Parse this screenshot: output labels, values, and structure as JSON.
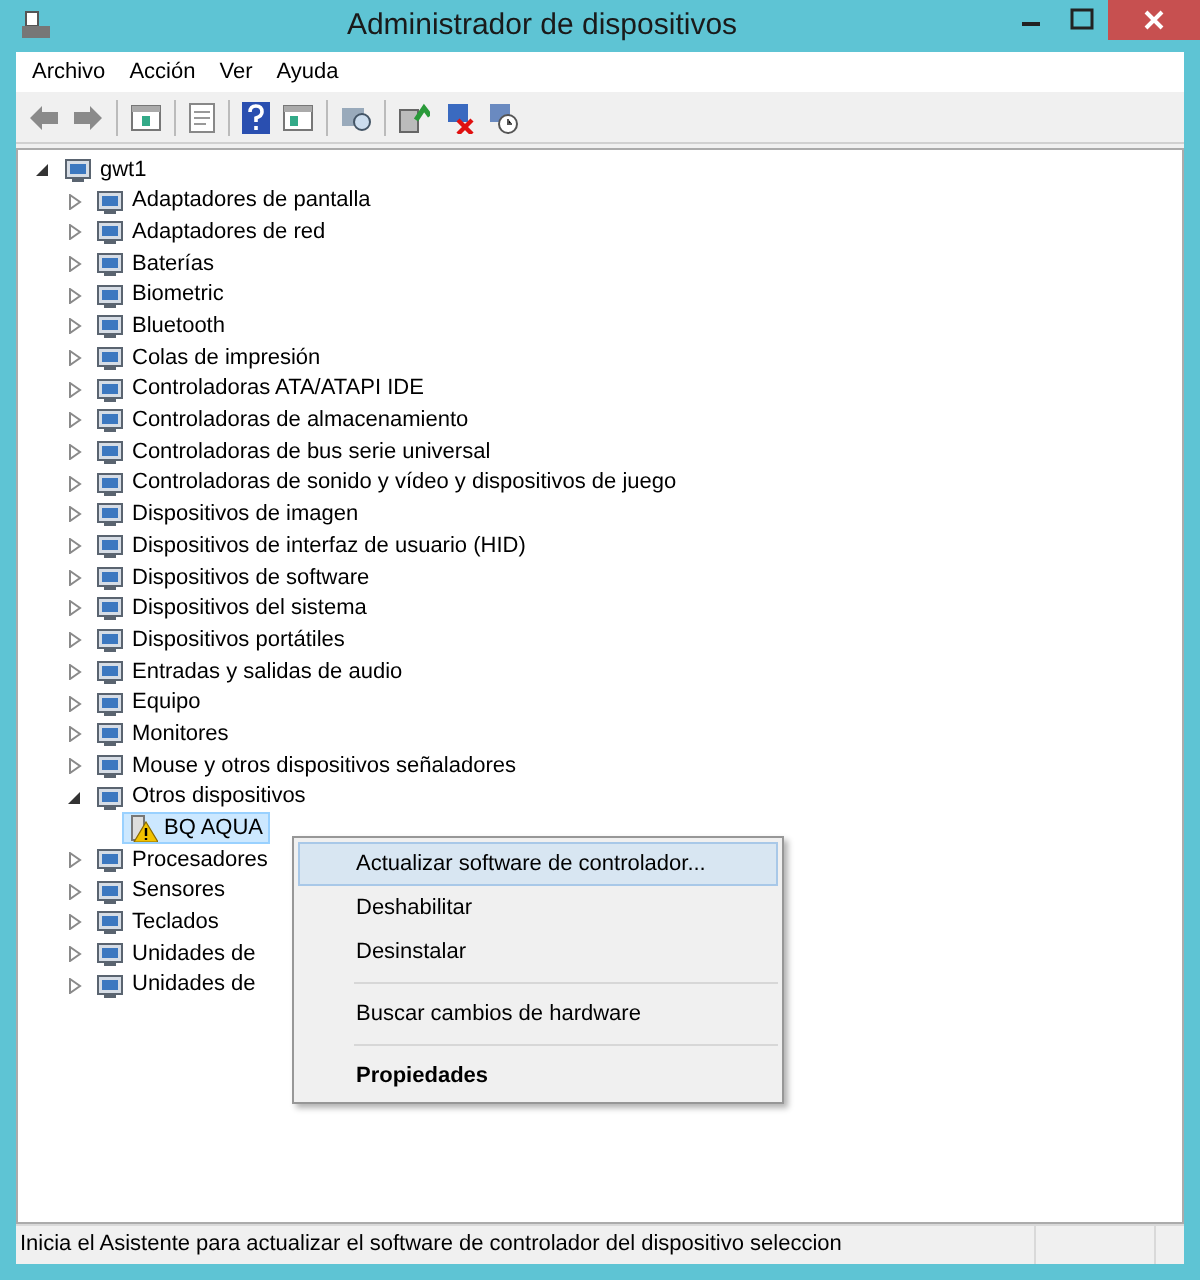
{
  "window": {
    "title": "Administrador de dispositivos"
  },
  "menu_bar": [
    "Archivo",
    "Acción",
    "Ver",
    "Ayuda"
  ],
  "tree": [
    {
      "label": "gwt1",
      "expanded": true,
      "selected": false,
      "children": [
        {
          "label": "Adaptadores de pantalla",
          "expanded": false,
          "selected": false
        },
        {
          "label": "Adaptadores de red",
          "expanded": false,
          "selected": false
        },
        {
          "label": "Baterías",
          "expanded": false,
          "selected": false
        },
        {
          "label": "Biometric",
          "expanded": false,
          "selected": false
        },
        {
          "label": "Bluetooth",
          "expanded": false,
          "selected": false
        },
        {
          "label": "Colas de impresión",
          "expanded": false,
          "selected": false
        },
        {
          "label": "Controladoras ATA/ATAPI IDE",
          "expanded": false,
          "selected": false
        },
        {
          "label": "Controladoras de almacenamiento",
          "expanded": false,
          "selected": false
        },
        {
          "label": "Controladoras de bus serie universal",
          "expanded": false,
          "selected": false
        },
        {
          "label": "Controladoras de sonido y vídeo y dispositivos de juego",
          "expanded": false,
          "selected": false
        },
        {
          "label": "Dispositivos de imagen",
          "expanded": false,
          "selected": false
        },
        {
          "label": "Dispositivos de interfaz de usuario (HID)",
          "expanded": false,
          "selected": false
        },
        {
          "label": "Dispositivos de software",
          "expanded": false,
          "selected": false
        },
        {
          "label": "Dispositivos del sistema",
          "expanded": false,
          "selected": false
        },
        {
          "label": "Dispositivos portátiles",
          "expanded": false,
          "selected": false
        },
        {
          "label": "Entradas y salidas de audio",
          "expanded": false,
          "selected": false
        },
        {
          "label": "Equipo",
          "expanded": false,
          "selected": false
        },
        {
          "label": "Monitores",
          "expanded": false,
          "selected": false
        },
        {
          "label": "Mouse y otros dispositivos señaladores",
          "expanded": false,
          "selected": false
        },
        {
          "label": "Otros dispositivos",
          "expanded": true,
          "selected": false,
          "children": [
            {
              "label": "BQ AQUA",
              "selected": true,
              "warning": true
            }
          ]
        },
        {
          "label": "Procesadores",
          "expanded": false,
          "selected": false
        },
        {
          "label": "Sensores",
          "expanded": false,
          "selected": false
        },
        {
          "label": "Teclados",
          "expanded": false,
          "selected": false
        },
        {
          "label": "Unidades de",
          "expanded": false,
          "selected": false
        },
        {
          "label": "Unidades de",
          "expanded": false,
          "selected": false
        }
      ]
    }
  ],
  "context_menu": [
    {
      "kind": "item",
      "label": "Actualizar software de controlador...",
      "selected": true,
      "default": false
    },
    {
      "kind": "item",
      "label": "Deshabilitar",
      "selected": false,
      "default": false
    },
    {
      "kind": "item",
      "label": "Desinstalar",
      "selected": false,
      "default": false
    },
    {
      "kind": "separator"
    },
    {
      "kind": "item",
      "label": "Buscar cambios de hardware",
      "selected": false,
      "default": false
    },
    {
      "kind": "separator"
    },
    {
      "kind": "item",
      "label": "Propiedades",
      "selected": false,
      "default": true
    }
  ],
  "status_bar": "Inicia el Asistente para actualizar el software de controlador del dispositivo seleccion"
}
